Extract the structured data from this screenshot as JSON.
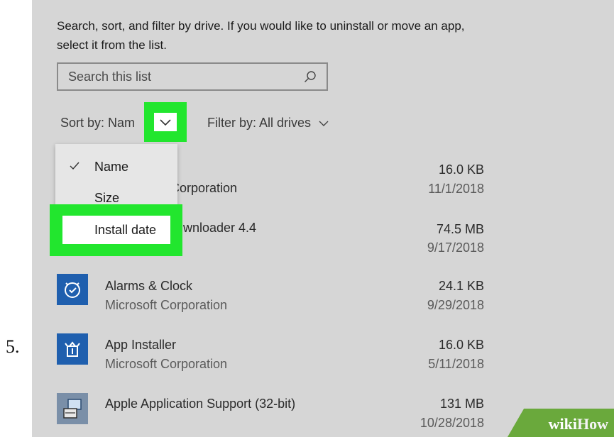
{
  "step_number": "5.",
  "description": "Search, sort, and filter by drive. If you would like to uninstall or move an app, select it from the list.",
  "search": {
    "placeholder": "Search this list"
  },
  "sort": {
    "label": "Sort by: Nam"
  },
  "filter": {
    "label": "Filter by: All drives"
  },
  "sort_menu": {
    "items": [
      "Name",
      "Size",
      "Install date"
    ],
    "selected": "Name"
  },
  "apps": [
    {
      "name_partial": "Corporation",
      "size": "16.0 KB",
      "date": "11/1/2018"
    },
    {
      "name_partial": "wnloader 4.4",
      "size": "74.5 MB",
      "date": "9/17/2018"
    },
    {
      "name": "Alarms & Clock",
      "publisher": "Microsoft Corporation",
      "size": "24.1 KB",
      "date": "9/29/2018",
      "icon": "alarm-clock-icon"
    },
    {
      "name": "App Installer",
      "publisher": "Microsoft Corporation",
      "size": "16.0 KB",
      "date": "5/11/2018",
      "icon": "package-icon"
    },
    {
      "name": "Apple Application Support (32-bit)",
      "size": "131 MB",
      "date": "10/28/2018",
      "icon": "installer-icon"
    }
  ],
  "watermark": {
    "part1": "wiki",
    "part2": "How"
  },
  "colors": {
    "highlight": "#22e62e",
    "panel": "#d6d6d6",
    "app_icon": "#1f5fae"
  }
}
